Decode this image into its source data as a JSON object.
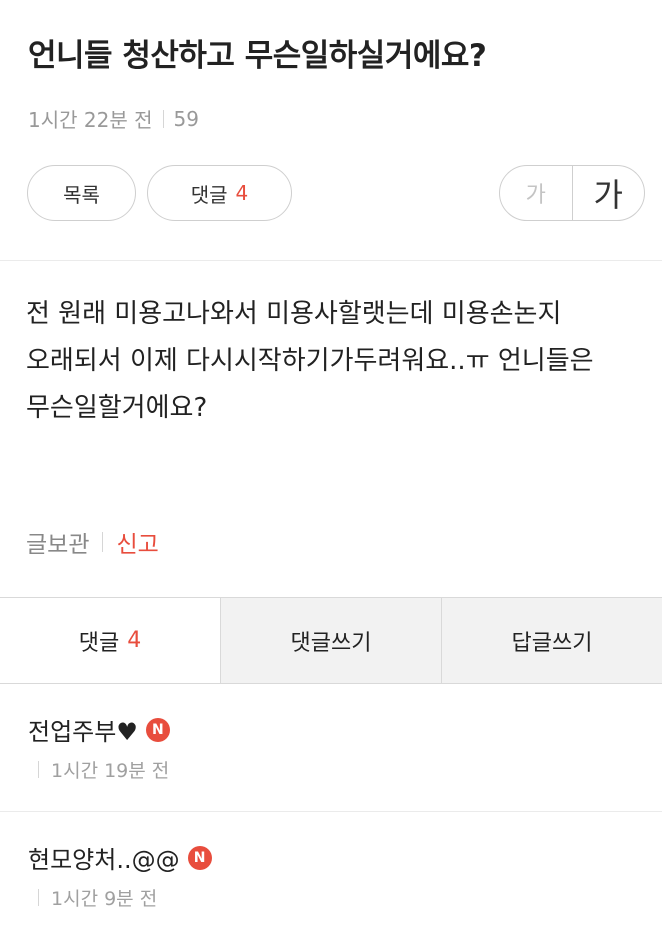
{
  "post": {
    "title": "언니들 청산하고 무슨일하실거에요?",
    "time": "1시간 22분 전",
    "views": "59",
    "list_label": "목록",
    "comment_label": "댓글",
    "comment_count": "4",
    "font_small_label": "가",
    "font_large_label": "가",
    "body": "전 원래 미용고나와서 미용사할랫는데 미용손논지 오래되서 이제 다시시작하기가두려워요..ㅠ 언니들은 무슨일할거에요?",
    "save_label": "글보관",
    "report_label": "신고"
  },
  "tabs": {
    "comments_label": "댓글",
    "comments_count": "4",
    "write_comment_label": "댓글쓰기",
    "write_reply_label": "답글쓰기"
  },
  "comments": [
    {
      "author": "전업주부♥",
      "badge": "N",
      "time": "1시간 19분 전"
    },
    {
      "author": "현모양처..@@",
      "badge": "N",
      "time": "1시간 9분 전"
    }
  ]
}
